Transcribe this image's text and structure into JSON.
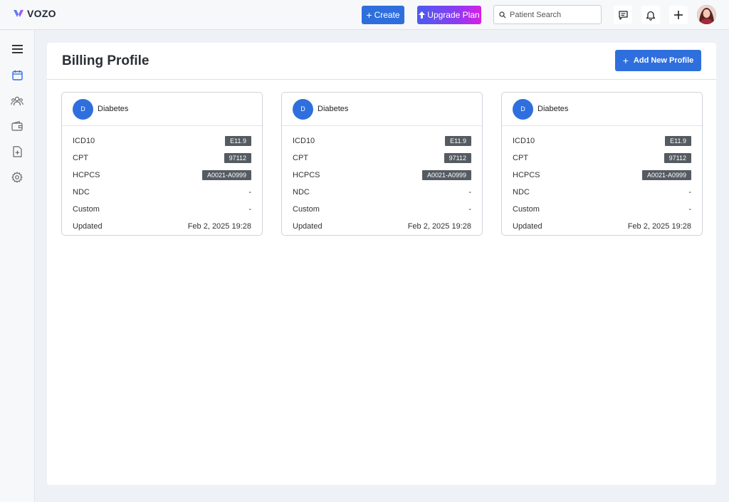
{
  "app": {
    "logo_text": "VOZO"
  },
  "topbar": {
    "create_label": "Create",
    "upgrade_label": "Upgrade Plan",
    "search_placeholder": "Patient Search"
  },
  "colors": {
    "primary": "#2f6fdd",
    "tag_bg": "#555b62",
    "page_bg": "#eef1f5"
  },
  "sidebar": {
    "items": [
      {
        "icon": "menu-icon"
      },
      {
        "icon": "calendar-icon"
      },
      {
        "icon": "users-icon"
      },
      {
        "icon": "wallet-icon"
      },
      {
        "icon": "document-add-icon"
      },
      {
        "icon": "gear-icon"
      }
    ]
  },
  "page": {
    "title": "Billing Profile",
    "add_label": "Add New Profile"
  },
  "cards": [
    {
      "initial": "D",
      "name": "Diabetes",
      "rows": [
        {
          "label": "ICD10",
          "value": "E11.9"
        },
        {
          "label": "CPT",
          "value": "97112"
        },
        {
          "label": "HCPCS",
          "value": "A0021-A0999"
        },
        {
          "label": "NDC",
          "value": "-"
        },
        {
          "label": "Custom",
          "value": "-"
        },
        {
          "label": "Updated",
          "value": "Feb 2, 2025 19:28"
        }
      ]
    },
    {
      "initial": "D",
      "name": "Diabetes",
      "rows": [
        {
          "label": "ICD10",
          "value": "E11.9"
        },
        {
          "label": "CPT",
          "value": "97112"
        },
        {
          "label": "HCPCS",
          "value": "A0021-A0999"
        },
        {
          "label": "NDC",
          "value": "-"
        },
        {
          "label": "Custom",
          "value": "-"
        },
        {
          "label": "Updated",
          "value": "Feb 2, 2025 19:28"
        }
      ]
    },
    {
      "initial": "D",
      "name": "Diabetes",
      "rows": [
        {
          "label": "ICD10",
          "value": "E11.9"
        },
        {
          "label": "CPT",
          "value": "97112"
        },
        {
          "label": "HCPCS",
          "value": "A0021-A0999"
        },
        {
          "label": "NDC",
          "value": "-"
        },
        {
          "label": "Custom",
          "value": "-"
        },
        {
          "label": "Updated",
          "value": "Feb 2, 2025 19:28"
        }
      ]
    }
  ]
}
